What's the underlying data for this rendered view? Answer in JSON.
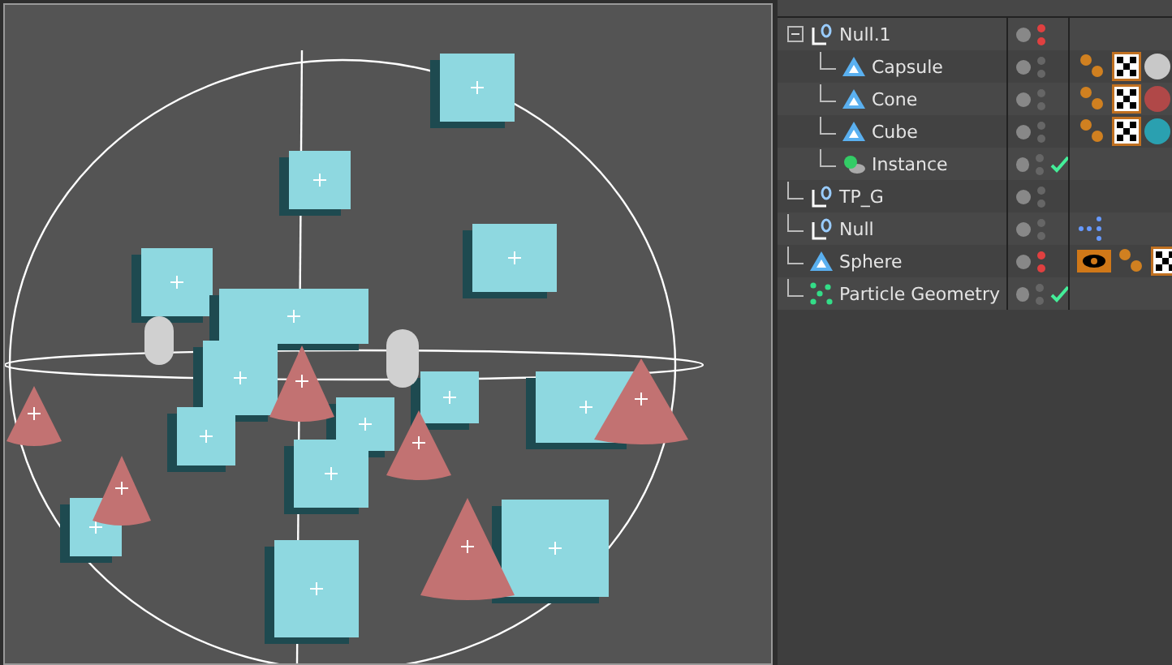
{
  "objects": [
    {
      "name": "Null.1",
      "kind": "null",
      "expanded": true,
      "hidden": true,
      "check": false,
      "children": [
        {
          "name": "Capsule",
          "kind": "primitive",
          "hidden": false,
          "check": false,
          "tags": [
            {
              "kind": "phong"
            },
            {
              "kind": "texture"
            },
            {
              "kind": "material",
              "color": "#c8c8c8"
            }
          ]
        },
        {
          "name": "Cone",
          "kind": "primitive",
          "hidden": false,
          "check": false,
          "tags": [
            {
              "kind": "phong"
            },
            {
              "kind": "texture"
            },
            {
              "kind": "material",
              "color": "#b04848"
            }
          ]
        },
        {
          "name": "Cube",
          "kind": "primitive",
          "hidden": false,
          "check": false,
          "tags": [
            {
              "kind": "phong"
            },
            {
              "kind": "texture"
            },
            {
              "kind": "material",
              "color": "#2aa0b0"
            }
          ]
        },
        {
          "name": "Instance",
          "kind": "instance",
          "hidden": false,
          "check": true
        }
      ]
    },
    {
      "name": "TP_G",
      "kind": "null",
      "hidden": false,
      "check": false
    },
    {
      "name": "Null",
      "kind": "null",
      "hidden": false,
      "check": false,
      "tags": [
        {
          "kind": "points"
        }
      ]
    },
    {
      "name": "Sphere",
      "kind": "primitive",
      "hidden": true,
      "check": false,
      "tags": [
        {
          "kind": "display"
        },
        {
          "kind": "phong"
        },
        {
          "kind": "texture"
        }
      ]
    },
    {
      "name": "Particle Geometry",
      "kind": "particles",
      "hidden": false,
      "check": true
    }
  ]
}
